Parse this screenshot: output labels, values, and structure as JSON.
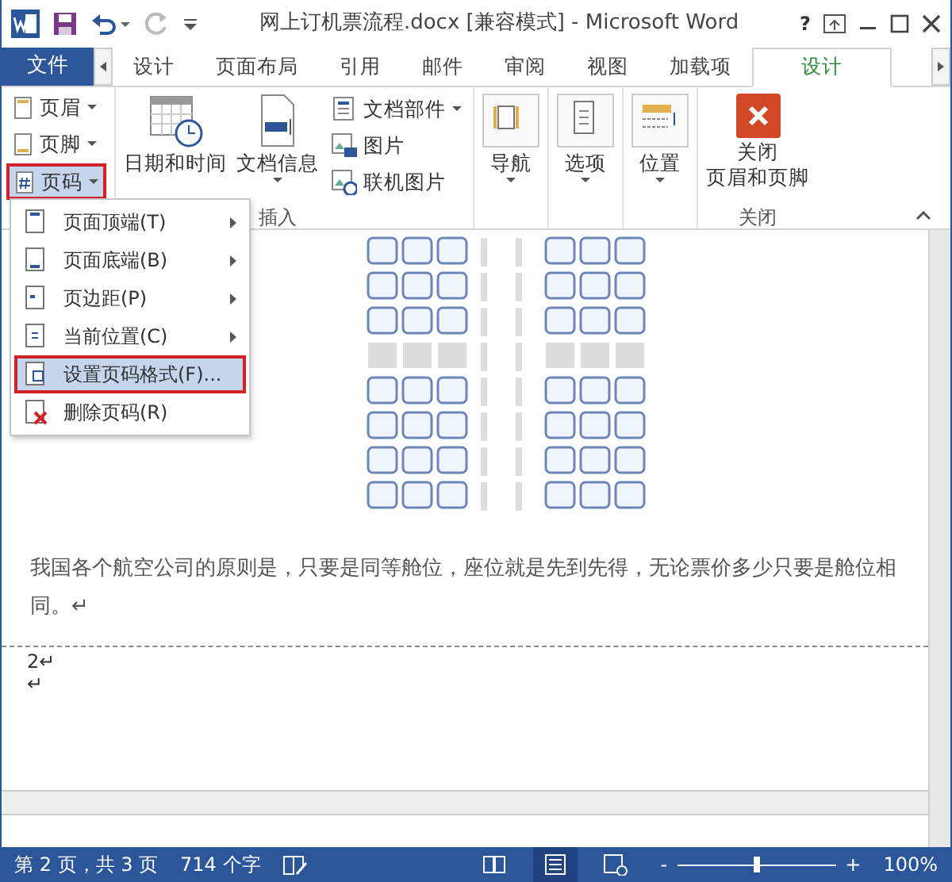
{
  "title_bar": {
    "title": "网上订机票流程.docx [兼容模式] - Microsoft Word",
    "help": "?"
  },
  "tabs": [
    {
      "label": "文件",
      "kind": "file",
      "selected": false
    },
    {
      "label": "设计",
      "kind": "tab",
      "selected": false
    },
    {
      "label": "页面布局",
      "kind": "tab",
      "selected": false
    },
    {
      "label": "引用",
      "kind": "tab",
      "selected": false
    },
    {
      "label": "邮件",
      "kind": "tab",
      "selected": false
    },
    {
      "label": "审阅",
      "kind": "tab",
      "selected": false
    },
    {
      "label": "视图",
      "kind": "tab",
      "selected": false
    },
    {
      "label": "加载项",
      "kind": "tab",
      "selected": false
    },
    {
      "label": "设计",
      "kind": "tab",
      "selected": true
    }
  ],
  "ribbon": {
    "header_footer": [
      {
        "label": "页眉",
        "open": false
      },
      {
        "label": "页脚",
        "open": false
      },
      {
        "label": "页码",
        "open": true
      }
    ],
    "date_time": "日期和时间",
    "doc_info": "文档信息",
    "small_buttons": [
      {
        "label": "文档部件",
        "dropdown": true
      },
      {
        "label": "图片",
        "dropdown": false
      },
      {
        "label": "联机图片",
        "dropdown": false
      }
    ],
    "insert_group": "插入",
    "option_buttons": [
      {
        "label": "导航"
      },
      {
        "label": "选项"
      },
      {
        "label": "位置"
      }
    ],
    "close_lines": [
      "关闭",
      "页眉和页脚"
    ],
    "close_group": "关闭"
  },
  "menu": [
    {
      "label": "页面顶端(T)",
      "submenu": true,
      "highlighted": false
    },
    {
      "label": "页面底端(B)",
      "submenu": true,
      "highlighted": false
    },
    {
      "label": "页边距(P)",
      "submenu": true,
      "highlighted": false
    },
    {
      "label": "当前位置(C)",
      "submenu": true,
      "highlighted": false
    },
    {
      "label": "设置页码格式(F)...",
      "submenu": false,
      "highlighted": true
    },
    {
      "label": "删除页码(R)",
      "submenu": false,
      "highlighted": false
    }
  ],
  "document": {
    "paragraph": "我国各个航空公司的原则是，只要是同等舱位，座位就是先到先得，无论票价多少只要是舱位相同。↵",
    "footer_lines": [
      "2↵",
      "↵"
    ]
  },
  "status_bar": {
    "page": "第 2 页，共 3 页",
    "words": "714 个字",
    "views": [
      {
        "selected": false
      },
      {
        "selected": true
      },
      {
        "selected": false
      }
    ],
    "zoom_out": "-",
    "zoom_slider": {
      "level": 0.5
    },
    "zoom_in": "+",
    "zoom": "100%"
  }
}
